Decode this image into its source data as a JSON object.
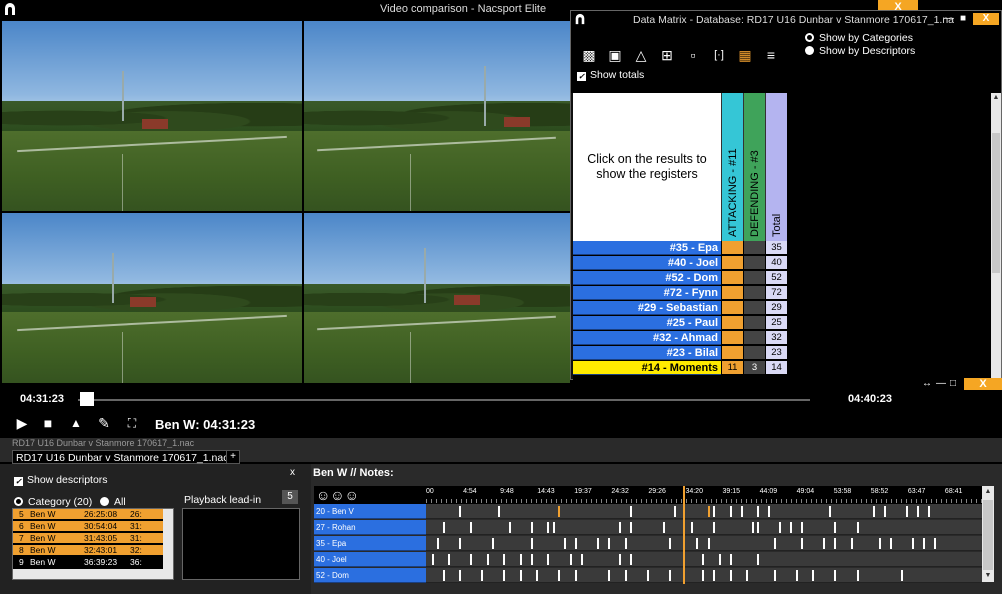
{
  "main_window": {
    "title": "Video comparison - Nacsport Elite",
    "close_label": "X"
  },
  "data_matrix": {
    "title": "Data Matrix - Database: RD17 U16 Dunbar v Stanmore 170617_1.na",
    "close_label": "X",
    "restore_label": "■",
    "minimize_label": "—",
    "toolbar_icons": [
      "comment-icon",
      "clapper-icon",
      "trash-icon",
      "grid-icon",
      "folder-icon",
      "bracket-icon",
      "matrix-icon",
      "sliders-icon"
    ],
    "view_options": [
      {
        "label": "Show by Categories",
        "selected": true
      },
      {
        "label": "Show by Descriptors",
        "selected": false
      }
    ],
    "show_totals": {
      "label": "Show totals",
      "checked": true
    },
    "corner_text": "Click on the results to show the registers",
    "columns": [
      {
        "label": "ATTACKING - #11",
        "color": "#35c6d6"
      },
      {
        "label": "DEFENDING - #3",
        "color": "#3fa35a"
      },
      {
        "label": "Total",
        "color": "#b4b4f0"
      }
    ],
    "rows": [
      {
        "label": "#35 - Epa",
        "att": "",
        "def": "",
        "total": "35"
      },
      {
        "label": "#40 - Joel",
        "att": "",
        "def": "",
        "total": "40"
      },
      {
        "label": "#52 - Dom",
        "att": "",
        "def": "",
        "total": "52"
      },
      {
        "label": "#72 - Fynn",
        "att": "",
        "def": "",
        "total": "72"
      },
      {
        "label": "#29 - Sebastian",
        "att": "",
        "def": "",
        "total": "29"
      },
      {
        "label": "#25 - Paul",
        "att": "",
        "def": "",
        "total": "25"
      },
      {
        "label": "#32 - Ahmad",
        "att": "",
        "def": "",
        "total": "32"
      },
      {
        "label": "#23 - Bilal",
        "att": "",
        "def": "",
        "total": "23"
      },
      {
        "label": "#14 - Moments",
        "att": "11",
        "def": "3",
        "total": "14",
        "highlight": true
      }
    ]
  },
  "player": {
    "current_time": "04:31:23",
    "end_time": "04:40:23",
    "now_label": "Ben W: 04:31:23",
    "progress": 0.003
  },
  "tabs": {
    "ghost": "RD17 U16 Dunbar v Stanmore 170617_1.nac",
    "active": "RD17 U16 Dunbar v Stanmore 170617_1.nac",
    "add_label": "+"
  },
  "descriptors_panel": {
    "show_descriptors": "Show descriptors",
    "close_label": "x",
    "filter_category": "Category (20)",
    "filter_all": "All",
    "category_rows": [
      {
        "num": "5",
        "name": "Ben W",
        "time": "26:25:08",
        "extra": "26:"
      },
      {
        "num": "6",
        "name": "Ben W",
        "time": "30:54:04",
        "extra": "31:"
      },
      {
        "num": "7",
        "name": "Ben W",
        "time": "31:43:05",
        "extra": "31:"
      },
      {
        "num": "8",
        "name": "Ben W",
        "time": "32:43:01",
        "extra": "32:"
      },
      {
        "num": "9",
        "name": "Ben W",
        "time": "36:39:23",
        "extra": "36:"
      }
    ],
    "playback_leadin_label": "Playback lead-in",
    "playback_leadin_value": "5"
  },
  "timeline": {
    "title": "Ben W // Notes:",
    "ticks": [
      "00",
      "4:54",
      "9:48",
      "14:43",
      "19:37",
      "24:32",
      "29:26",
      "34:20",
      "39:15",
      "44:09",
      "49:04",
      "53:58",
      "58:52",
      "63:47",
      "68:41"
    ],
    "rows": [
      {
        "label": "20 - Ben V",
        "marks": [
          0.06,
          0.13,
          0.24,
          0.37,
          0.45,
          0.51,
          0.52,
          0.55,
          0.57,
          0.6,
          0.62,
          0.73,
          0.81,
          0.83,
          0.87,
          0.89,
          0.91
        ]
      },
      {
        "label": "27 - Rohan",
        "marks": [
          0.03,
          0.08,
          0.15,
          0.19,
          0.22,
          0.23,
          0.35,
          0.37,
          0.43,
          0.48,
          0.52,
          0.59,
          0.6,
          0.64,
          0.66,
          0.68,
          0.74,
          0.78
        ]
      },
      {
        "label": "35 - Epa",
        "marks": [
          0.02,
          0.06,
          0.12,
          0.19,
          0.25,
          0.27,
          0.31,
          0.33,
          0.36,
          0.44,
          0.49,
          0.51,
          0.63,
          0.68,
          0.72,
          0.74,
          0.77,
          0.82,
          0.84,
          0.88,
          0.9,
          0.92
        ]
      },
      {
        "label": "40 - Joel",
        "marks": [
          0.01,
          0.04,
          0.08,
          0.11,
          0.14,
          0.17,
          0.19,
          0.22,
          0.26,
          0.28,
          0.35,
          0.37,
          0.5,
          0.53,
          0.55,
          0.6
        ]
      },
      {
        "label": "52 - Dom",
        "marks": [
          0.03,
          0.06,
          0.1,
          0.14,
          0.17,
          0.2,
          0.24,
          0.27,
          0.33,
          0.36,
          0.4,
          0.44,
          0.5,
          0.52,
          0.55,
          0.58,
          0.63,
          0.67,
          0.7,
          0.74,
          0.78,
          0.86
        ]
      }
    ]
  }
}
